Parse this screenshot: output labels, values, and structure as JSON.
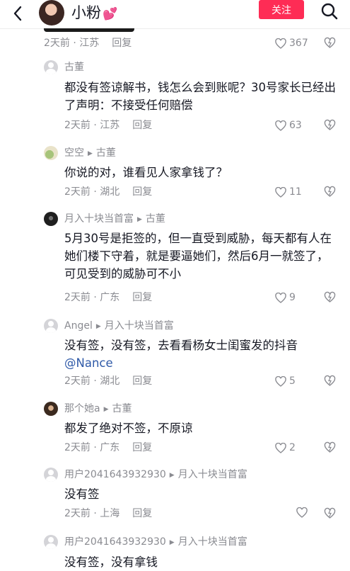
{
  "header": {
    "back_icon": "chevron-left-icon",
    "user_name": "小粉",
    "emoji": "💕",
    "follow_label": "关注",
    "search_icon": "search-icon",
    "accent": "#fe2c55"
  },
  "prev_comment": {
    "time": "2天前",
    "location": "江苏",
    "reply": "回复",
    "likes": "367"
  },
  "comments": [
    {
      "user": "古董",
      "reply_to": "",
      "text": "都没有签谅解书，钱怎么会到账呢？30号家长已经出了声明：不接受任何赔偿",
      "time": "2天前",
      "location": "江苏",
      "reply": "回复",
      "likes": "63"
    },
    {
      "user": "空空",
      "reply_to": "古董",
      "text": "你说的对，谁看见人家拿钱了？",
      "time": "2天前",
      "location": "湖北",
      "reply": "回复",
      "likes": "11"
    },
    {
      "user": "月入十块当首富",
      "reply_to": "古董",
      "text": "5月30号是拒签的，但一直受到威胁，每天都有人在她们楼下守着，就是要逼她们，然后6月一就签了，可见受到的威胁可不小",
      "time": "2天前",
      "location": "广东",
      "reply": "回复",
      "likes": "9"
    },
    {
      "user": "Angel",
      "reply_to": "月入十块当首富",
      "text": "没有签，没有签，去看看杨女士闺蜜发的抖音",
      "mention": "@Nance",
      "time": "2天前",
      "location": "湖北",
      "reply": "回复",
      "likes": "5"
    },
    {
      "user": "那个她a",
      "reply_to": "古董",
      "text": "都发了绝对不签，不原谅",
      "time": "2天前",
      "location": "广东",
      "reply": "回复",
      "likes": "2"
    },
    {
      "user": "用户2041643932930",
      "reply_to": "月入十块当首富",
      "text": "没有签",
      "time": "2天前",
      "location": "上海",
      "reply": "回复",
      "likes": ""
    },
    {
      "user": "用户2041643932930",
      "reply_to": "月入十块当首富",
      "text": "没有签，没有拿钱"
    }
  ]
}
